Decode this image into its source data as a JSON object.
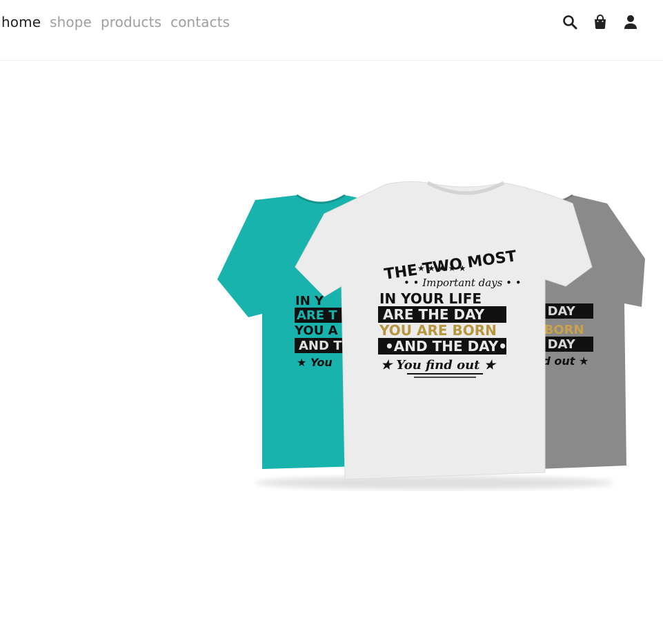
{
  "nav": {
    "links": [
      {
        "label": "home",
        "active": true
      },
      {
        "label": "shope",
        "active": false
      },
      {
        "label": "products",
        "active": false
      },
      {
        "label": "contacts",
        "active": false
      }
    ],
    "icons": [
      "search-icon",
      "shopping-bag-icon",
      "user-icon"
    ]
  },
  "hero": {
    "image": {
      "tshirt_colors": [
        "#19b3ad",
        "#e9e9e9",
        "#8a8a8a"
      ],
      "print": {
        "line1": "THE TWO MOST",
        "line2": "Important days",
        "line3": "IN YOUR LIFE",
        "line4": "ARE THE DAY",
        "line5": "YOU ARE BORN",
        "line6": "AND THE DAY",
        "line7": "You find out"
      }
    }
  },
  "colors": {
    "nav_active": "#222222",
    "nav_inactive": "#9e9e9e",
    "print_gold": "#b8963e"
  }
}
